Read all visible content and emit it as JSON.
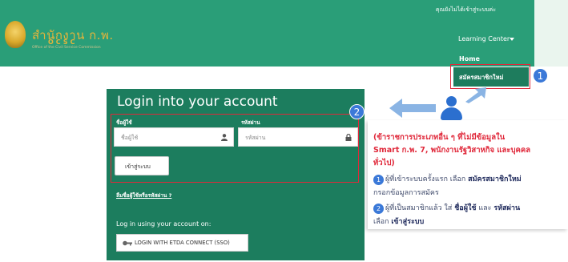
{
  "header": {
    "not_logged_in": "คุณยังไม่ได้เข้าสู่ระบบค่ะ",
    "brand_name": "สำนักงาน ก.พ.",
    "brand_abbr": "OCSC",
    "brand_tagline": "Office of the Civil Service Commission",
    "menu_label": "Learning Center",
    "colors": {
      "header_bg": "#2a9e78",
      "brand_gold": "#e2b43b"
    }
  },
  "dropdown": {
    "items": [
      {
        "label": "Home"
      },
      {
        "label": "สมัครสมาชิกใหม่"
      }
    ]
  },
  "badges": {
    "one": "1",
    "two": "2"
  },
  "login": {
    "title": "Login into your account",
    "username_label": "ชื่อผู้ใช้",
    "username_placeholder": "ชื่อผู้ใช้",
    "password_label": "รหัสผ่าน",
    "password_placeholder": "รหัสผ่าน",
    "submit_label": "เข้าสู่ระบบ",
    "forgot_link": "ลืมชื่อผู้ใช้หรือรหัสผ่าน ?",
    "alt_login_text": "Log in using your account on:",
    "etda_button": "LOGIN WITH ETDA CONNECT (SSO)",
    "colors": {
      "panel_bg": "#1c7d5e",
      "highlight": "#e0283a"
    }
  },
  "info": {
    "red_line1": "(ข้าราชการประเภทอื่น ๆ ที่ไม่มีข้อมูลใน",
    "red_line2": "Smart ก.พ. 7, พนักงานรัฐวิสาหกิจ และบุคคล",
    "red_line3": "ทั่วไป)",
    "step1_text": "ผู้ที่เข้าระบบครั้งแรก เลือก",
    "step1_bold": "สมัครสมาชิกใหม่",
    "step1_cont": "กรอกข้อมูลการสมัคร",
    "step2_text": "ผู้ที่เป็นสมาชิกแล้ว ใส่",
    "step2_bold1": "ชื่อผู้ใช้",
    "step2_and": "และ",
    "step2_bold2": "รหัสผ่าน",
    "step2_cont": "เลือก",
    "step2_bold3": "เข้าสู่ระบบ"
  },
  "icons": [
    "user-icon",
    "lock-icon",
    "key-icon",
    "person-icon",
    "arrow-left-icon",
    "arrow-up-icon",
    "caret-down-icon",
    "emblem-icon"
  ]
}
